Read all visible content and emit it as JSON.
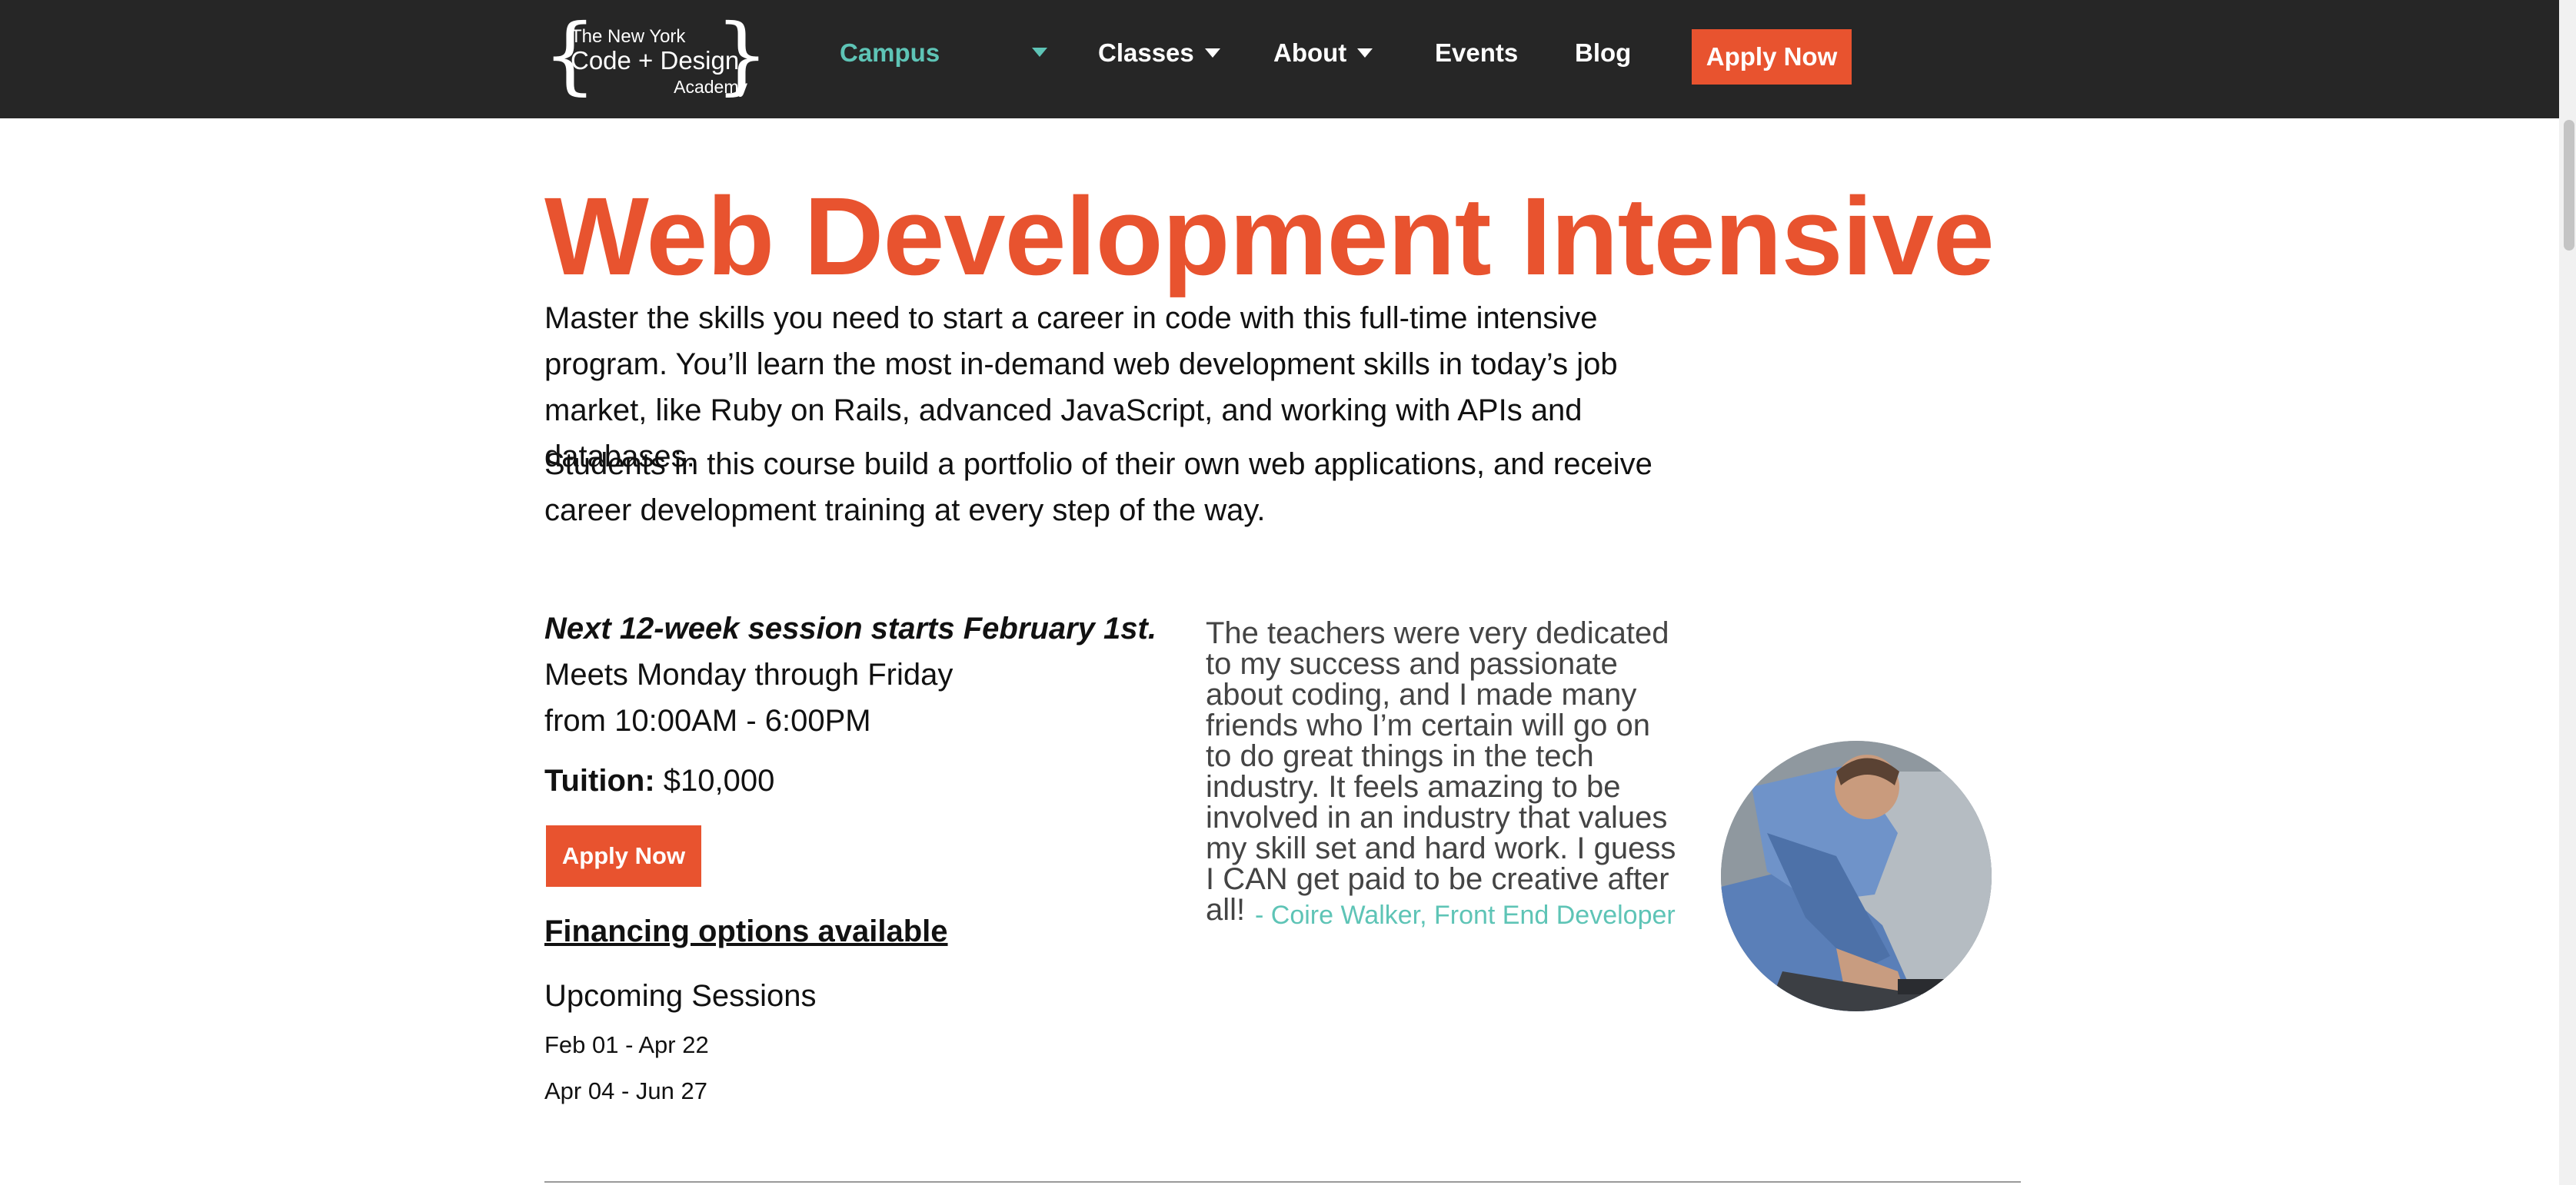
{
  "header": {
    "logo": {
      "line1": "The New York",
      "line2": "Code + Design",
      "line3": "Academy"
    },
    "nav": [
      {
        "label": "Campus"
      },
      {
        "label": "Classes"
      },
      {
        "label": "About"
      },
      {
        "label": "Events"
      },
      {
        "label": "Blog"
      }
    ],
    "apply_label": "Apply Now"
  },
  "main": {
    "title": "Web Development Intensive",
    "intro_1": "Master the skills you need to start a career in code with this full-time intensive program. You’ll learn the most in-demand web development skills in today’s job market, like Ruby on Rails, advanced JavaScript, and working with APIs and databases.",
    "intro_2": "Students in this course build a portfolio of their own web applications, and receive career development training at every step of the way.",
    "session_heading": "Next 12-week session starts February 1st.",
    "meets": "Meets Monday through Friday",
    "hours": "from 10:00AM - 6:00PM",
    "tuition_label": "Tuition:",
    "tuition_value": "$10,000",
    "apply_label": "Apply Now",
    "financing_label": "Financing options available",
    "upcoming_heading": "Upcoming Sessions",
    "sessions": [
      "Feb 01 - Apr 22",
      "Apr 04 - Jun 27"
    ]
  },
  "testimonial": {
    "quote": "The teachers were very dedicated to my success and passionate about coding, and I made many friends who I’m certain will go on to do great things in the tech industry. It feels amazing to be involved in an industry that values my skill set and hard work. I guess I CAN get paid to be creative after all!",
    "attribution": "- Coire Walker, Front End Developer"
  },
  "colors": {
    "accent": "#e8532f",
    "teal": "#5ec4b6",
    "topbar": "#262626"
  }
}
